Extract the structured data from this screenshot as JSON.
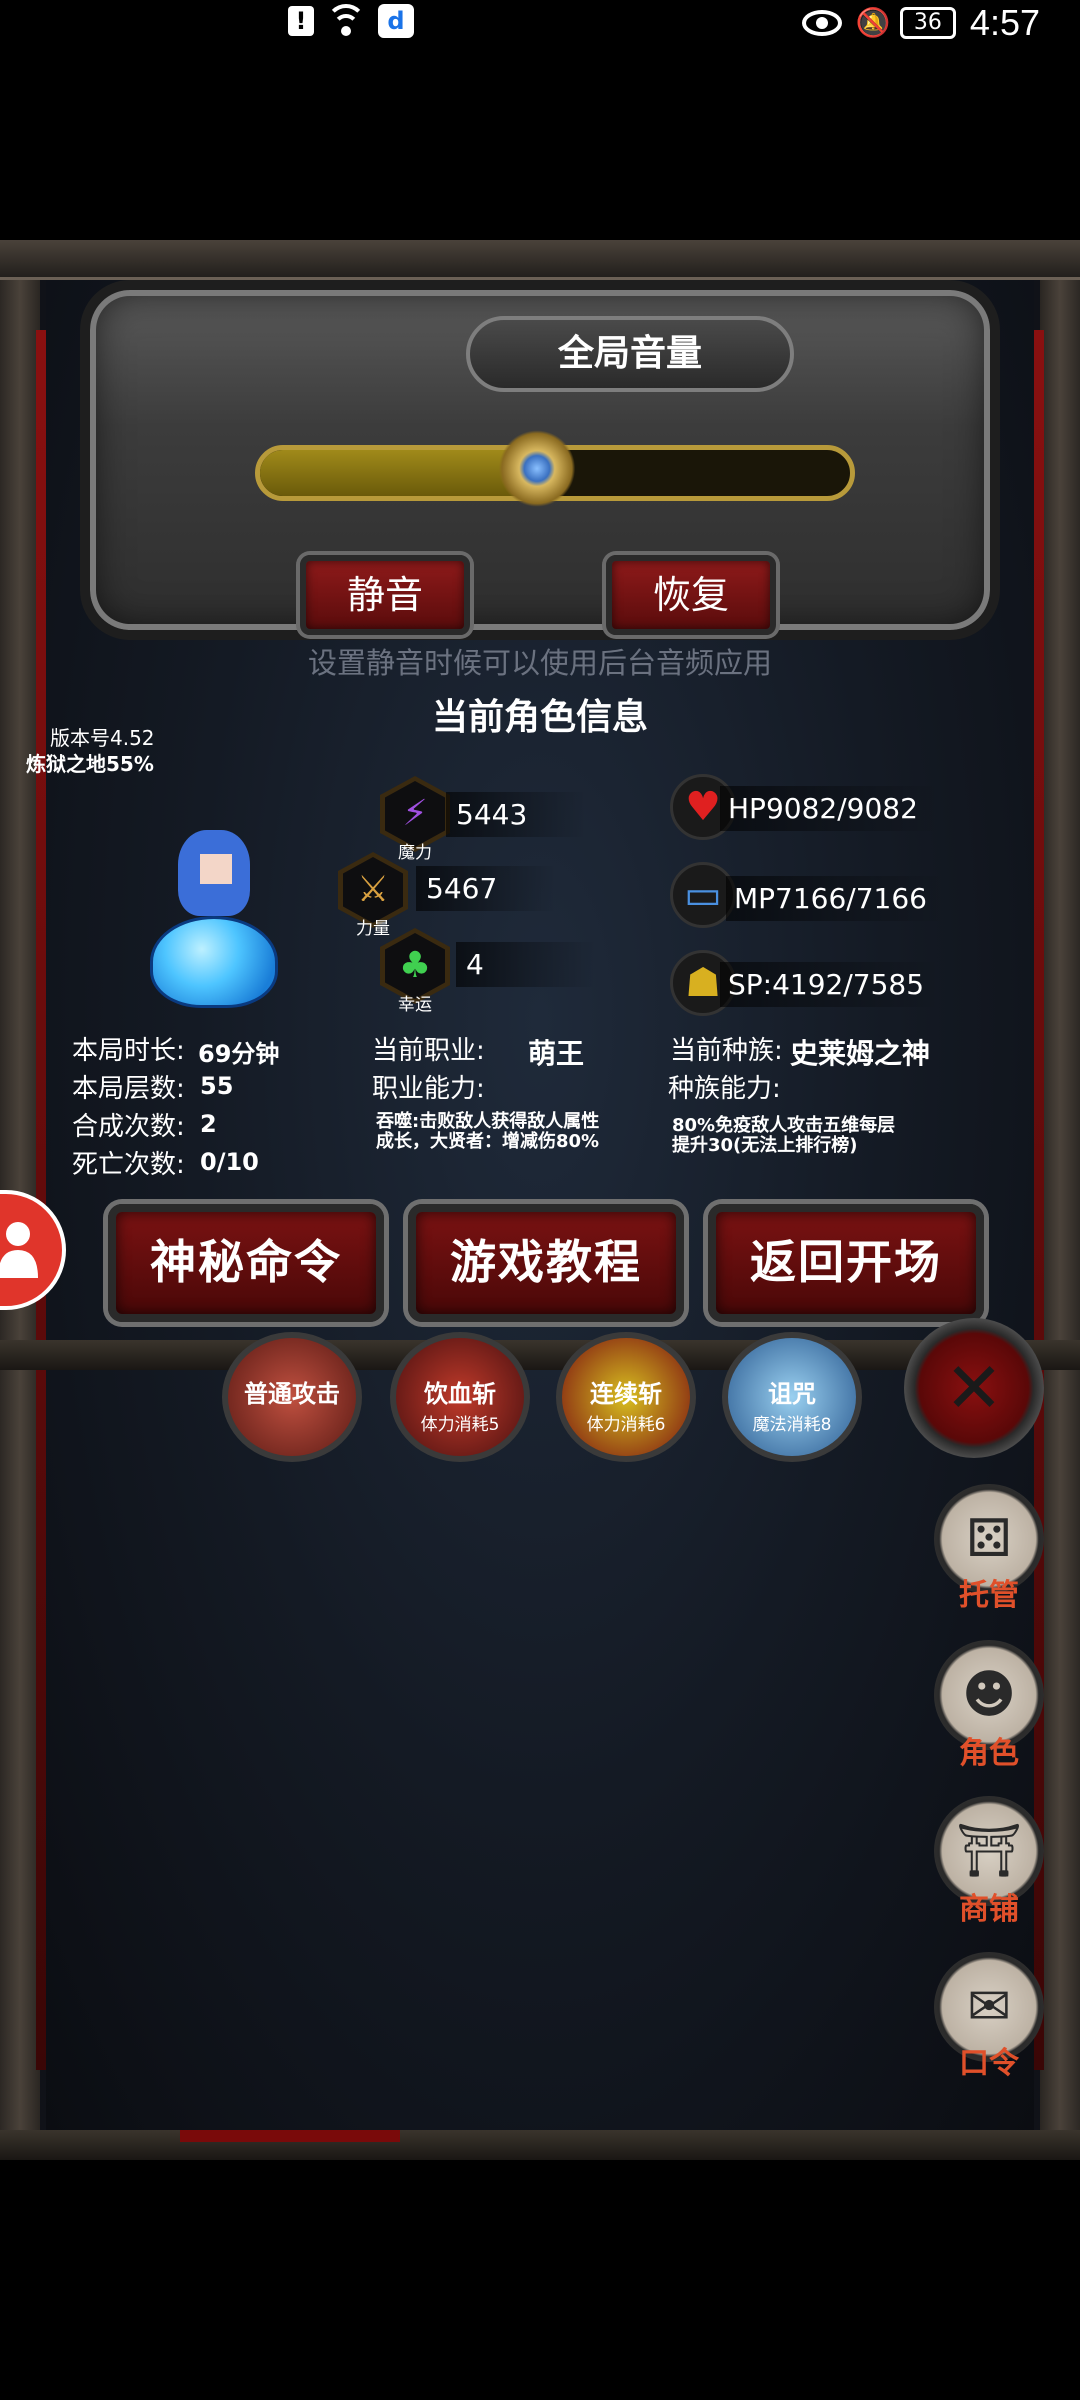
{
  "status_bar": {
    "time": "4:57",
    "battery": "36",
    "alert_glyph": "!",
    "app_glyph": "d"
  },
  "volume": {
    "title": "全局音量",
    "level": 0.47,
    "mute_label": "静音",
    "restore_label": "恢复",
    "hint": "设置静音时候可以使用后台音频应用"
  },
  "info": {
    "title": "当前角色信息",
    "version": "版本号4.52",
    "zone": "炼狱之地55%",
    "stats": {
      "magic": {
        "caption": "魔力",
        "value": "5443"
      },
      "strength": {
        "caption": "力量",
        "value": "5467"
      },
      "luck": {
        "caption": "幸运",
        "value": "4"
      }
    },
    "resources": {
      "hp": "HP9082/9082",
      "mp": "MP7166/7166",
      "sp": "SP:4192/7585"
    },
    "session": {
      "duration_label": "本局时长:",
      "duration_value": "69分钟",
      "floors_label": "本局层数:",
      "floors_value": "55",
      "synth_label": "合成次数:",
      "synth_value": "2",
      "deaths_label": "死亡次数:",
      "deaths_value": "0/10"
    },
    "job": {
      "label": "当前职业:",
      "value": "萌王",
      "ability_label": "职业能力:",
      "ability_text_1": "吞噬:击败敌人获得敌人属性",
      "ability_text_2": "成长，大贤者：增减伤80%"
    },
    "race": {
      "label": "当前种族:",
      "value": "史莱姆之神",
      "ability_label": "种族能力:",
      "ability_text_1": "80%免疫敌人攻击五维每层",
      "ability_text_2": "提升30(无法上排行榜)"
    }
  },
  "commands": {
    "secret": "神秘命令",
    "tutorial": "游戏教程",
    "back": "返回开场"
  },
  "skills": [
    {
      "name": "普通攻击",
      "cost": ""
    },
    {
      "name": "饮血斩",
      "cost": "体力消耗5"
    },
    {
      "name": "连续斩",
      "cost": "体力消耗6"
    },
    {
      "name": "诅咒",
      "cost": "魔法消耗8"
    }
  ],
  "side_menu": {
    "auto": "托管",
    "character": "角色",
    "shop": "商铺",
    "code": "口令"
  },
  "colors": {
    "accent_red": "#8e1a1a",
    "menu_label": "#e0502a",
    "volume_fill": "#a08a1a"
  },
  "icons": {
    "close": "✕",
    "bell_muted": "🔕",
    "dice": "⚄",
    "hood": "☻",
    "shop": "⛩",
    "scroll": "✉",
    "magic": "⚡",
    "strength": "⚔",
    "luck": "♣",
    "hp": "♥",
    "mp": "▭",
    "sp": "☗"
  }
}
